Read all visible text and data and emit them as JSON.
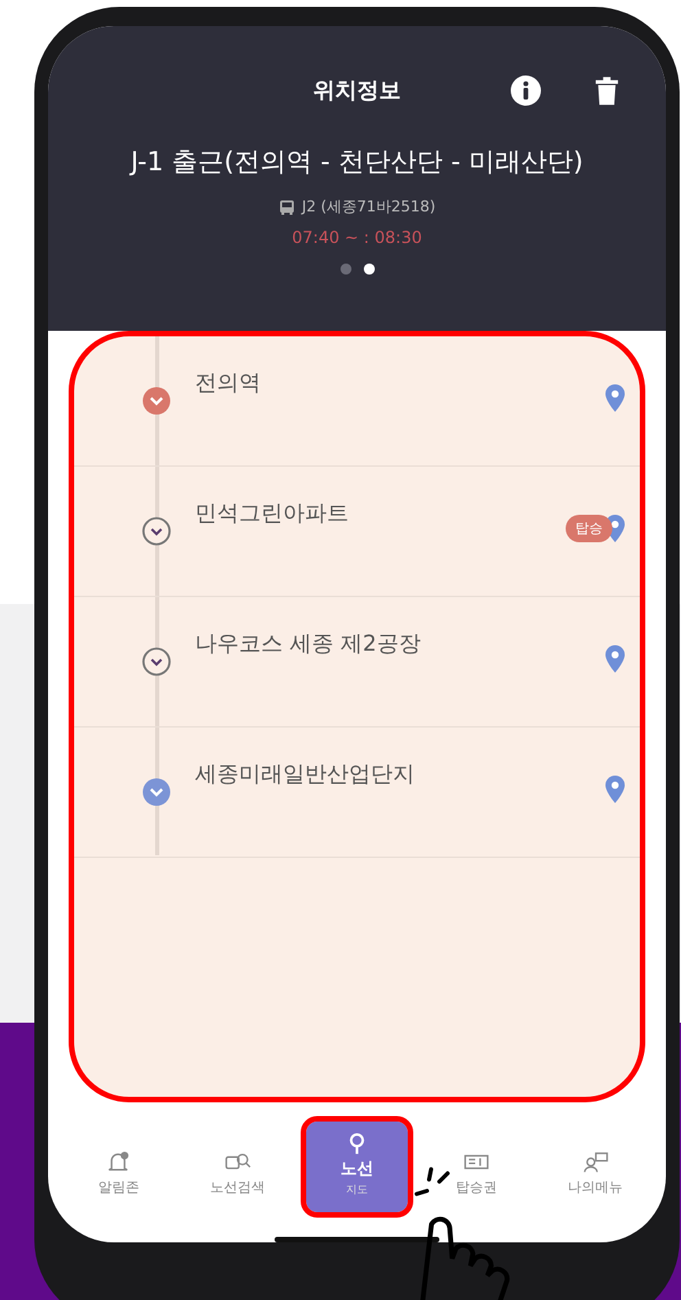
{
  "header": {
    "title": "위치정보"
  },
  "route": {
    "title": "J-1 출근(전의역 - 천단산단 - 미래산단)",
    "bus": "J2 (세종71바2518)",
    "time": "07:40 ~ : 08:30"
  },
  "pager": [
    {
      "selected": false
    },
    {
      "selected": true
    }
  ],
  "stops": [
    {
      "kind": "first",
      "name": "전의역"
    },
    {
      "kind": "middle",
      "name": "민석그린아파트",
      "badge": "탑승"
    },
    {
      "kind": "middle",
      "name": "나우코스 세종 제2공장"
    },
    {
      "kind": "last",
      "name": "세종미래일반산업단지"
    }
  ],
  "tabs": [
    {
      "kind": "bell",
      "label": "알림존",
      "selected": false
    },
    {
      "kind": "search",
      "label": "노선검색",
      "selected": false
    },
    {
      "kind": "pin",
      "label": "노선",
      "sub": "지도",
      "selected": true
    },
    {
      "kind": "ticket",
      "label": "탑승권",
      "selected": false
    },
    {
      "kind": "user",
      "label": "나의메뉴",
      "selected": false
    }
  ]
}
